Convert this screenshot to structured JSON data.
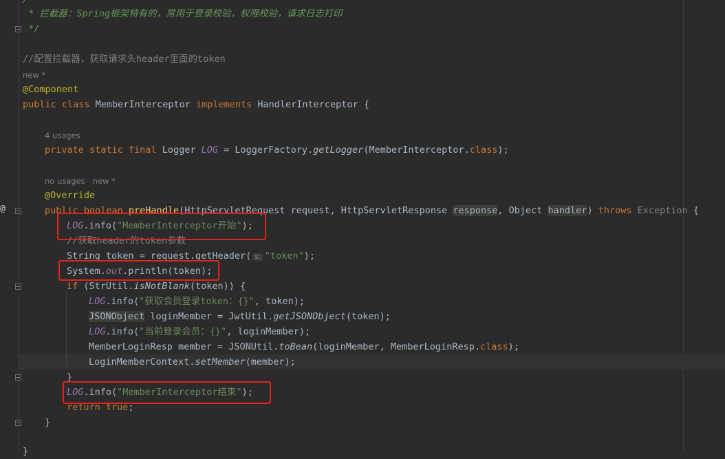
{
  "editor": {
    "lines": {
      "l1": "/**",
      "l2": " * 拦截器：Spring框架特有的，常用于登录校验，权限校验，请求日志打印",
      "l3": " */",
      "l4": "//配置拦截器，获取请求头header里面的token",
      "hint_new1": "new *",
      "l5": "@Component",
      "l6_kw": "public class",
      "l6_name": " MemberInterceptor ",
      "l6_impl": "implements",
      "l6_rest": " HandlerInterceptor {",
      "hint_usages": "4 usages",
      "l7_kw": "private static final",
      "l7_type": " Logger ",
      "l7_field": "LOG",
      "l7_mid": " = LoggerFactory.",
      "l7_method": "getLogger",
      "l7_arg": "(MemberInterceptor.",
      "l7_class": "class",
      "l7_end": ");",
      "hint_no_usages": "no usages",
      "hint_new2": "new *",
      "l8": "@Override",
      "l9_kw": "public boolean ",
      "l9_fn": "preHandle",
      "l9_a": "(HttpServletRequest request, HttpServletResponse ",
      "l9_resp": "response",
      "l9_b": ", Object ",
      "l9_handler": "handler",
      "l9_c": ") ",
      "l9_throws": "throws",
      "l9_exc": " Exception",
      "l9_brace": " {",
      "l10_log": "LOG",
      "l10_mid": ".info(",
      "l10_str": "\"MemberInterceptor开始\"",
      "l10_end": ");",
      "l11": "//获取header的token参数",
      "l12_a": "String token = request.getHeader(",
      "l12_hint": "s:",
      "l12_str": "\"token\"",
      "l12_end": ");",
      "l13_a": "System.",
      "l13_out": "out",
      "l13_b": ".println(token);",
      "l14_kw": "if",
      "l14_a": " (StrUtil.",
      "l14_m": "isNotBlank",
      "l14_b": "(token)) {",
      "l15_log": "LOG",
      "l15_mid": ".info(",
      "l15_str": "\"获取会员登录token：{}\"",
      "l15_end": ", token);",
      "l16_type": "JSONObject",
      "l16_a": " loginMember = JwtUtil.",
      "l16_m": "getJSONObject",
      "l16_b": "(token);",
      "l17_log": "LOG",
      "l17_mid": ".info(",
      "l17_str": "\"当前登录会员：{}\"",
      "l17_end": ", loginMember);",
      "l18_a": "MemberLoginResp member = JSONUtil.",
      "l18_m": "toBean",
      "l18_b": "(loginMember, MemberLoginResp.",
      "l18_class": "class",
      "l18_end": ");",
      "l19_a": "LoginMemberContext.",
      "l19_m": "setMember",
      "l19_b": "(member);",
      "l20": "}",
      "l21_log": "LOG",
      "l21_mid": ".info(",
      "l21_str": "\"MemberInterceptor结束\"",
      "l21_end": ");",
      "l22_kw": "return true",
      "l22_end": ";",
      "l23": "}",
      "l24": "}"
    },
    "gutter_symbol": "@",
    "colors": {
      "background": "#2b2b2b",
      "keyword": "#cc7832",
      "string": "#6a8759",
      "annotation": "#bbb529",
      "field": "#9876aa",
      "method": "#ffc66d",
      "highlight_box": "#e2231a"
    }
  }
}
